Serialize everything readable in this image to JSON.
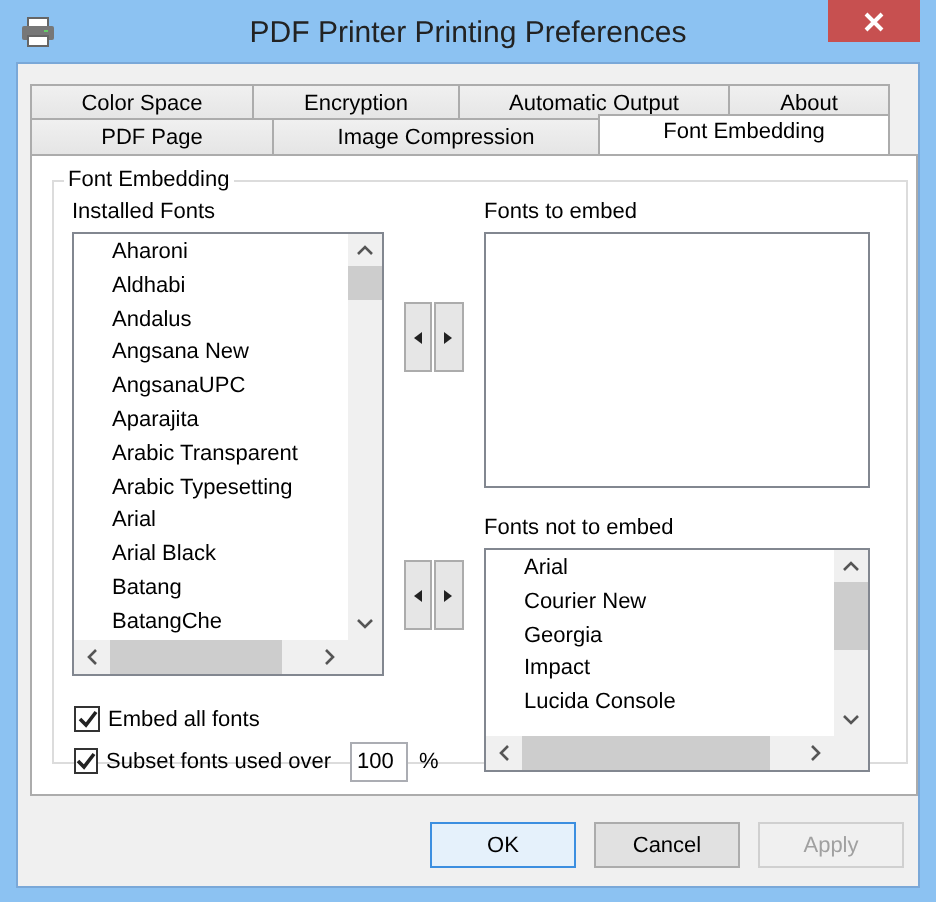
{
  "window": {
    "title": "PDF Printer Printing Preferences"
  },
  "tab_rows": [
    {
      "tabs": [
        {
          "label": "Color Space",
          "selected": false
        },
        {
          "label": "Encryption",
          "selected": false
        },
        {
          "label": "Automatic Output",
          "selected": false
        },
        {
          "label": "About",
          "selected": false
        }
      ]
    },
    {
      "tabs": [
        {
          "label": "PDF Page",
          "selected": false
        },
        {
          "label": "Image Compression",
          "selected": false
        },
        {
          "label": "Font Embedding",
          "selected": true
        }
      ]
    }
  ],
  "group": {
    "title": "Font Embedding"
  },
  "installed_fonts": {
    "label": "Installed Fonts",
    "items": [
      "Aharoni",
      "Aldhabi",
      "Andalus",
      "Angsana New",
      "AngsanaUPC",
      "Aparajita",
      "Arabic Transparent",
      "Arabic Typesetting",
      "Arial",
      "Arial Black",
      "Batang",
      "BatangChe"
    ]
  },
  "fonts_to_embed": {
    "label": "Fonts to embed"
  },
  "fonts_not_to_embed": {
    "label": "Fonts not to embed",
    "items": [
      "Arial",
      "Courier New",
      "Georgia",
      "Impact",
      "Lucida Console"
    ]
  },
  "options": [
    {
      "kind": "checkbox",
      "label": "Embed all fonts",
      "checked": true
    },
    {
      "kind": "checkbox_field",
      "label": "Subset fonts used over",
      "checked": true,
      "value": "100",
      "unit": "%"
    }
  ],
  "buttons": [
    {
      "label": "OK",
      "default": true,
      "disabled": false
    },
    {
      "label": "Cancel",
      "default": false,
      "disabled": false
    },
    {
      "label": "Apply",
      "default": false,
      "disabled": true
    }
  ]
}
